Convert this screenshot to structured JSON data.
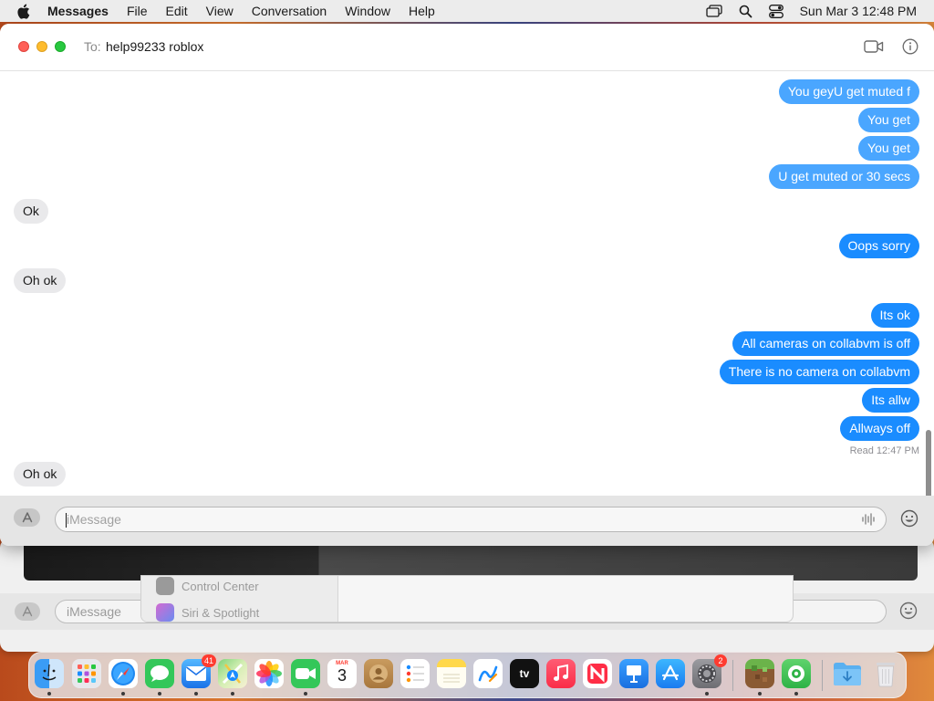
{
  "menubar": {
    "app_name": "Messages",
    "items": [
      "File",
      "Edit",
      "View",
      "Conversation",
      "Window",
      "Help"
    ],
    "clock": "Sun Mar 3  12:48 PM"
  },
  "header": {
    "to_label": "To:",
    "recipient": "help99233 roblox"
  },
  "messages": [
    {
      "side": "sent",
      "text": "You geyU get muted f"
    },
    {
      "side": "sent",
      "text": "You get"
    },
    {
      "side": "sent",
      "text": "You get"
    },
    {
      "side": "sent",
      "text": "U get muted or 30 secs"
    },
    {
      "side": "received",
      "text": "Ok"
    },
    {
      "side": "sent",
      "text": "Oops sorry"
    },
    {
      "side": "received",
      "text": "Oh ok"
    },
    {
      "side": "sent",
      "text": "Its ok"
    },
    {
      "side": "sent",
      "text": "All cameras on collabvm is off"
    },
    {
      "side": "sent",
      "text": "There is no camera on collabvm"
    },
    {
      "side": "sent",
      "text": "Its allw"
    },
    {
      "side": "sent",
      "text": "Allways off"
    },
    {
      "side": "received",
      "text": "Oh ok"
    }
  ],
  "read_receipt": "Read 12:47 PM",
  "composer": {
    "placeholder": "iMessage"
  },
  "background": {
    "settings_items": [
      "Control Center",
      "Siri & Spotlight"
    ],
    "composer_placeholder": "iMessage"
  },
  "dock": {
    "apps": [
      {
        "name": "Finder",
        "icon": "finder-icon",
        "running": true
      },
      {
        "name": "Launchpad",
        "icon": "launchpad-icon",
        "running": false
      },
      {
        "name": "Safari",
        "icon": "safari-icon",
        "running": true
      },
      {
        "name": "Messages",
        "icon": "messages-icon",
        "running": true
      },
      {
        "name": "Mail",
        "icon": "mail-icon",
        "running": true,
        "badge": "41"
      },
      {
        "name": "Maps",
        "icon": "maps-icon",
        "running": true
      },
      {
        "name": "Photos",
        "icon": "photos-icon",
        "running": false
      },
      {
        "name": "FaceTime",
        "icon": "facetime-icon",
        "running": true
      },
      {
        "name": "Calendar",
        "icon": "calendar-icon",
        "running": false,
        "month": "MAR",
        "day": "3"
      },
      {
        "name": "Contacts",
        "icon": "contacts-icon",
        "running": false
      },
      {
        "name": "Reminders",
        "icon": "reminders-icon",
        "running": false
      },
      {
        "name": "Notes",
        "icon": "notes-icon",
        "running": false
      },
      {
        "name": "Freeform",
        "icon": "freeform-icon",
        "running": false
      },
      {
        "name": "TV",
        "icon": "appletv-icon",
        "running": false,
        "label": "tv"
      },
      {
        "name": "Music",
        "icon": "music-icon",
        "running": false
      },
      {
        "name": "News",
        "icon": "news-icon",
        "running": false
      },
      {
        "name": "Keynote",
        "icon": "keynote-icon",
        "running": false
      },
      {
        "name": "App Store",
        "icon": "appstore-icon",
        "running": false
      },
      {
        "name": "System Settings",
        "icon": "system-settings-icon",
        "running": true,
        "badge": "2"
      },
      {
        "name": "Minecraft",
        "icon": "minecraft-icon",
        "running": true
      },
      {
        "name": "Find My",
        "icon": "findmy-icon",
        "running": true
      },
      {
        "name": "Downloads",
        "icon": "downloads-folder-icon",
        "running": false
      },
      {
        "name": "Trash",
        "icon": "trash-icon",
        "running": false
      }
    ]
  },
  "colors": {
    "sent_bubble": "#1a8cff",
    "received_bubble": "#e9e9eb",
    "badge": "#ff3b30"
  }
}
